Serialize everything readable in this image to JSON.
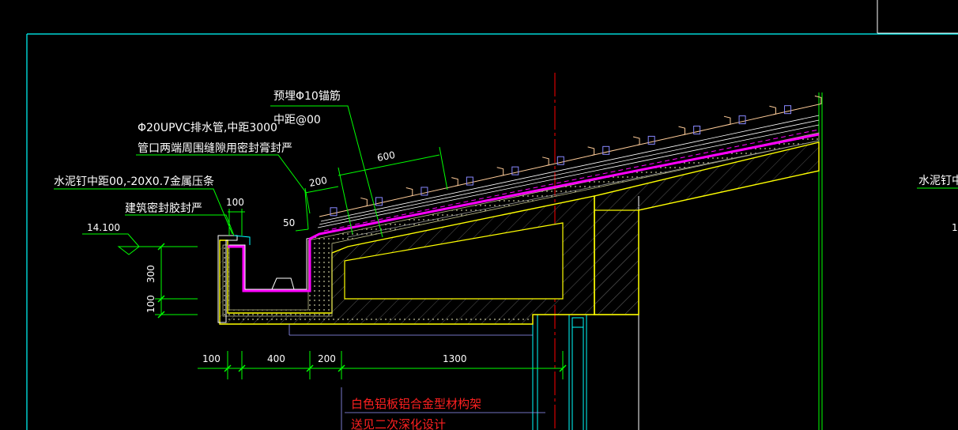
{
  "annotations": {
    "embedded_rebar": "预埋Φ10锚筋",
    "rebar_spacing": "中距@00",
    "drain_pipe": "Φ20UPVC排水管,中距3000",
    "pipe_seal": "管口两端周围缝隙用密封膏封严",
    "cement_nail": "水泥钉中距00,-20X0.7金属压条",
    "sealant": "建筑密封胶封严",
    "cement_nail_right": "水泥钉中",
    "elevation": "14.100",
    "red_note_1": "白色铝板铝合金型材构架",
    "red_note_2": "送见二次深化设计",
    "edge_digit": "1"
  },
  "dimensions": {
    "d_600": "600",
    "d_200_top": "200",
    "d_100_top": "100",
    "d_50": "50",
    "d_300": "300",
    "d_100_left": "100",
    "d_100_bottom": "100",
    "d_400": "400",
    "d_200_bottom": "200",
    "d_1300": "1300"
  },
  "colors": {
    "background": "#000000",
    "frame": "#00ffff",
    "leader": "#00ff00",
    "concrete": "#ffff00",
    "membrane": "#ff00ff",
    "section_line": "#ff0000",
    "tile": "#ffcc99",
    "text": "#ffffff",
    "note": "#ff2020"
  }
}
